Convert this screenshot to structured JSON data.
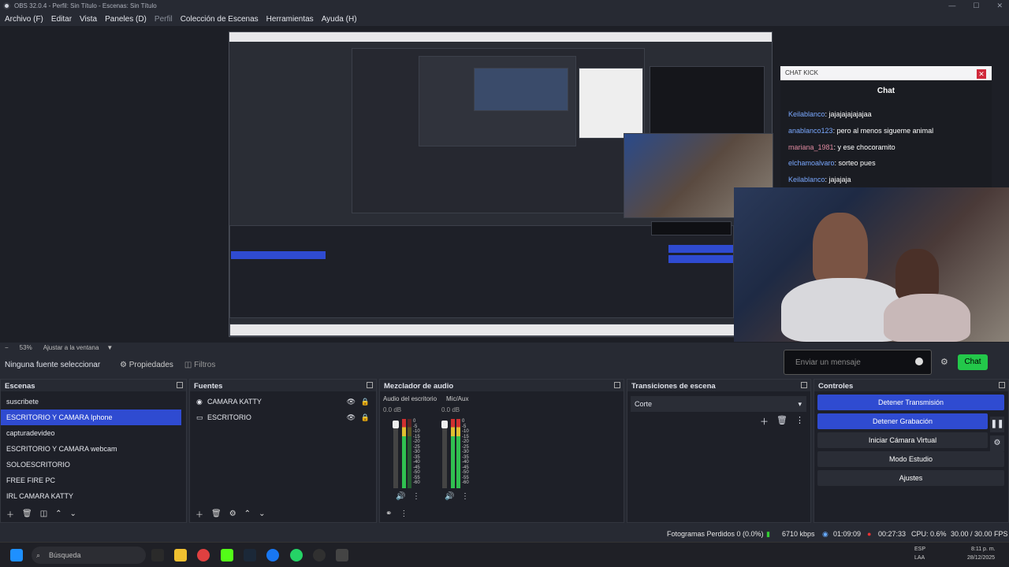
{
  "window": {
    "title": "OBS 32.0.4 - Perfil: Sin Título - Escenas: Sin Título"
  },
  "menu": [
    "Archivo (F)",
    "Editar",
    "Vista",
    "Paneles (D)",
    "Perfil",
    "Colección de Escenas",
    "Herramientas",
    "Ayuda (H)"
  ],
  "chat": {
    "window_title": "CHAT KICK",
    "heading": "Chat",
    "messages": [
      {
        "user": "Keilablanco",
        "text": ": jajajajajajajaa"
      },
      {
        "user": "anablanco123",
        "text": ": pero al menos sigueme animal"
      },
      {
        "user": "mariana_1981",
        "text": ": y ese chocoramito"
      },
      {
        "user": "elchamoalvaro",
        "text": ": sorteo pues"
      },
      {
        "user": "Keilablanco",
        "text": ": jajajaja"
      }
    ],
    "input_placeholder": "Enviar un mensaje",
    "send_label": "Chat"
  },
  "preview": {
    "zoom": "53%",
    "fit_label": "Ajustar a la ventana"
  },
  "source_toolbar": {
    "no_source": "Ninguna fuente seleccionar",
    "properties": "Propiedades",
    "filters": "Filtros"
  },
  "scenes": {
    "title": "Escenas",
    "items": [
      "suscribete",
      "ESCRITORIO Y CAMARA Iphone",
      "capturadevideo",
      "ESCRITORIO Y CAMARA webcam",
      "SOLOESCRITORIO",
      "FREE FIRE PC",
      "IRL CAMARA KATTY"
    ],
    "selected": 1
  },
  "sources": {
    "title": "Fuentes",
    "items": [
      "CAMARA KATTY",
      "ESCRITORIO"
    ]
  },
  "mixer": {
    "title": "Mezclador de audio",
    "channels": [
      {
        "name": "Audio del escritorio",
        "db": "0.0 dB"
      },
      {
        "name": "Mic/Aux",
        "db": "0.0 dB"
      }
    ],
    "scale": [
      "0",
      "-5",
      "-10",
      "-15",
      "-20",
      "-25",
      "-30",
      "-35",
      "-40",
      "-45",
      "-50",
      "-55",
      "-60"
    ]
  },
  "transitions": {
    "title": "Transiciones de escena",
    "selected": "Corte"
  },
  "controls": {
    "title": "Controles",
    "stop_stream": "Detener Transmisión",
    "stop_record": "Detener Grabación",
    "virtual_cam": "Iniciar Cámara Virtual",
    "studio": "Modo Estudio",
    "settings": "Ajustes"
  },
  "status": {
    "dropped": "Fotogramas Perdidos 0 (0.0%)",
    "bitrate": "6710 kbps",
    "stream_time": "01:09:09",
    "rec_time": "00:27:33",
    "cpu": "CPU: 0.6%",
    "fps": "30.00 / 30.00 FPS"
  },
  "taskbar": {
    "search": "Búsqueda",
    "lang": "ESP",
    "lang2": "LAA",
    "time": "8:11 p. m.",
    "date": "28/12/2025"
  },
  "colors": {
    "accent": "#2f4bd1",
    "kick_green": "#23c84a",
    "bg": "#272a33"
  }
}
